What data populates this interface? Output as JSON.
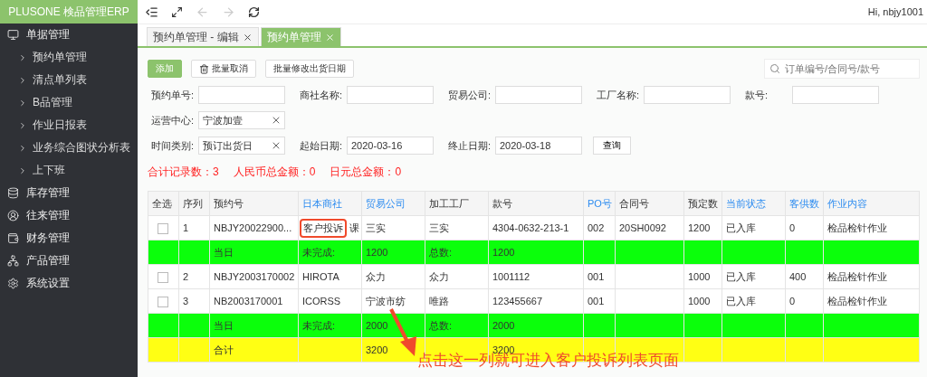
{
  "app_title": "PLUSONE 検品管理ERP",
  "topbar": {
    "greeting": "Hi, nbjy1001",
    "forward_disabled": true
  },
  "sidebar": {
    "items": [
      {
        "label": "单据管理",
        "children": [
          {
            "label": "预约单管理"
          },
          {
            "label": "清点单列表"
          },
          {
            "label": "B品管理"
          },
          {
            "label": "作业日报表"
          },
          {
            "label": "业务综合图状分析表"
          },
          {
            "label": "上下班"
          }
        ]
      },
      {
        "label": "库存管理"
      },
      {
        "label": "往来管理"
      },
      {
        "label": "财务管理"
      },
      {
        "label": "产品管理"
      },
      {
        "label": "系统设置"
      }
    ]
  },
  "tabs": [
    {
      "label": "预约单管理 - 编辑",
      "selected": false
    },
    {
      "label": "预约单管理",
      "selected": true
    }
  ],
  "toolbar": {
    "buttons": [
      {
        "label": "添加",
        "kind": "primary"
      },
      {
        "label": "批量取消",
        "kind": "trash"
      },
      {
        "label": "批量修改出货日期",
        "kind": "plain"
      }
    ],
    "search": {
      "placeholder": "订单编号/合同号/款号"
    }
  },
  "form": {
    "rows": [
      [
        {
          "label": "预约单号:"
        },
        {
          "label": "商社名称:"
        },
        {
          "label": "贸易公司:"
        },
        {
          "label": "工厂名称:"
        },
        {
          "label": "款号:"
        }
      ],
      [
        {
          "label": "运营中心:",
          "value": "宁波加壹",
          "clearable": true
        }
      ],
      [
        {
          "label": "时间类别:",
          "value": "预订出货日",
          "clearable": true
        },
        {
          "label": "起始日期:",
          "value": "2020-03-16"
        },
        {
          "label": "终止日期:",
          "value": "2020-03-18"
        }
      ]
    ],
    "query_button": "查询"
  },
  "summary": [
    "合计记录数：3",
    "人民币总金额：0",
    "日元总金额：0"
  ],
  "table": {
    "columns": [
      {
        "label": "全选",
        "link": false
      },
      {
        "label": "序列",
        "link": false
      },
      {
        "label": "预约号",
        "link": false
      },
      {
        "label": "日本商社",
        "link": true
      },
      {
        "label": "贸易公司",
        "link": true
      },
      {
        "label": "加工工厂",
        "link": false
      },
      {
        "label": "款号",
        "link": false
      },
      {
        "label": "PO号",
        "link": true
      },
      {
        "label": "合同号",
        "link": false
      },
      {
        "label": "预定数",
        "link": false
      },
      {
        "label": "当前状态",
        "link": true
      },
      {
        "label": "客供数",
        "link": true
      },
      {
        "label": "作业内容",
        "link": true
      }
    ],
    "rows": [
      {
        "kind": "data",
        "popup": "客户投诉",
        "cells": [
          {
            "checked": false
          },
          "1",
          "NBJY20022900...",
          "课",
          "三实",
          "三实",
          "4304-0632-213-1",
          "002",
          "20SH0092",
          "1200",
          "已入库",
          "0",
          "检品检针作业"
        ]
      },
      {
        "kind": "subtotal",
        "cells": [
          "",
          "",
          "当日",
          "未完成:",
          "1200",
          "总数:",
          "1200",
          "",
          "",
          "",
          "",
          "",
          ""
        ]
      },
      {
        "kind": "data",
        "cells": [
          {
            "checked": false
          },
          "2",
          "NBJY2003170002",
          "HIROTA",
          "众力",
          "众力",
          "1001112",
          "001",
          "",
          "1000",
          "已入库",
          "400",
          "检品检针作业"
        ]
      },
      {
        "kind": "data",
        "cells": [
          {
            "checked": false
          },
          "3",
          "NB2003170001",
          "ICORSS",
          "宁波市纺",
          "唯路",
          "123455667",
          "001",
          "",
          "1000",
          "已入库",
          "0",
          "检品检针作业"
        ]
      },
      {
        "kind": "subtotal",
        "cells": [
          "",
          "",
          "当日",
          "未完成:",
          "2000",
          "总数:",
          "2000",
          "",
          "",
          "",
          "",
          "",
          ""
        ]
      },
      {
        "kind": "total",
        "cells": [
          "",
          "",
          "合计",
          "",
          "3200",
          "",
          "3200",
          "",
          "",
          "",
          "",
          "",
          ""
        ]
      }
    ]
  },
  "annotation": "点击这一列就可进入客户投诉列表页面"
}
